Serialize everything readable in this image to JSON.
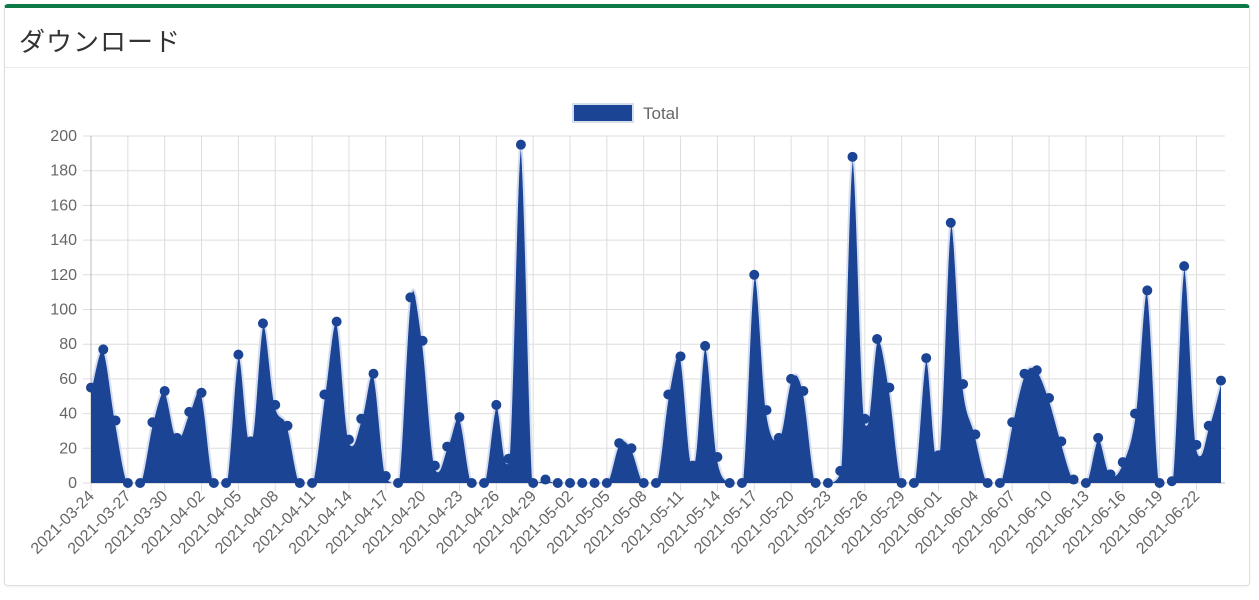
{
  "header": {
    "title": "ダウンロード"
  },
  "colors": {
    "accent": "#0f7a45",
    "series": "#1b4495",
    "grid": "#dddddd",
    "axis_text": "#666666"
  },
  "chart_data": {
    "type": "area",
    "title": "",
    "xlabel": "",
    "ylabel": "",
    "ylim": [
      0,
      200
    ],
    "yticks": [
      0,
      20,
      40,
      60,
      80,
      100,
      120,
      140,
      160,
      180,
      200
    ],
    "grid": true,
    "legend_position": "top-center",
    "tick_labels": [
      "2021-03-24",
      "2021-03-27",
      "2021-03-30",
      "2021-04-02",
      "2021-04-05",
      "2021-04-08",
      "2021-04-11",
      "2021-04-14",
      "2021-04-17",
      "2021-04-20",
      "2021-04-23",
      "2021-04-26",
      "2021-04-29",
      "2021-05-02",
      "2021-05-05",
      "2021-05-08",
      "2021-05-11",
      "2021-05-14",
      "2021-05-17",
      "2021-05-20",
      "2021-05-23",
      "2021-05-26",
      "2021-05-29",
      "2021-06-01",
      "2021-06-04",
      "2021-06-07",
      "2021-06-10",
      "2021-06-13",
      "2021-06-16",
      "2021-06-19",
      "2021-06-22"
    ],
    "x_start": "2021-03-24",
    "series": [
      {
        "name": "Total",
        "values": [
          55,
          77,
          36,
          0,
          0,
          35,
          53,
          26,
          41,
          52,
          0,
          0,
          74,
          24,
          92,
          45,
          33,
          0,
          0,
          51,
          93,
          25,
          37,
          63,
          4,
          0,
          107,
          82,
          10,
          21,
          38,
          0,
          0,
          45,
          14,
          195,
          0,
          2,
          0,
          0,
          0,
          0,
          0,
          23,
          20,
          0,
          0,
          51,
          73,
          10,
          79,
          15,
          0,
          0,
          120,
          42,
          26,
          60,
          53,
          0,
          0,
          7,
          188,
          37,
          83,
          55,
          0,
          0,
          72,
          16,
          150,
          57,
          28,
          0,
          0,
          35,
          63,
          65,
          49,
          24,
          2,
          0,
          26,
          5,
          12,
          40,
          111,
          0,
          1,
          125,
          22,
          33,
          59
        ]
      }
    ]
  }
}
